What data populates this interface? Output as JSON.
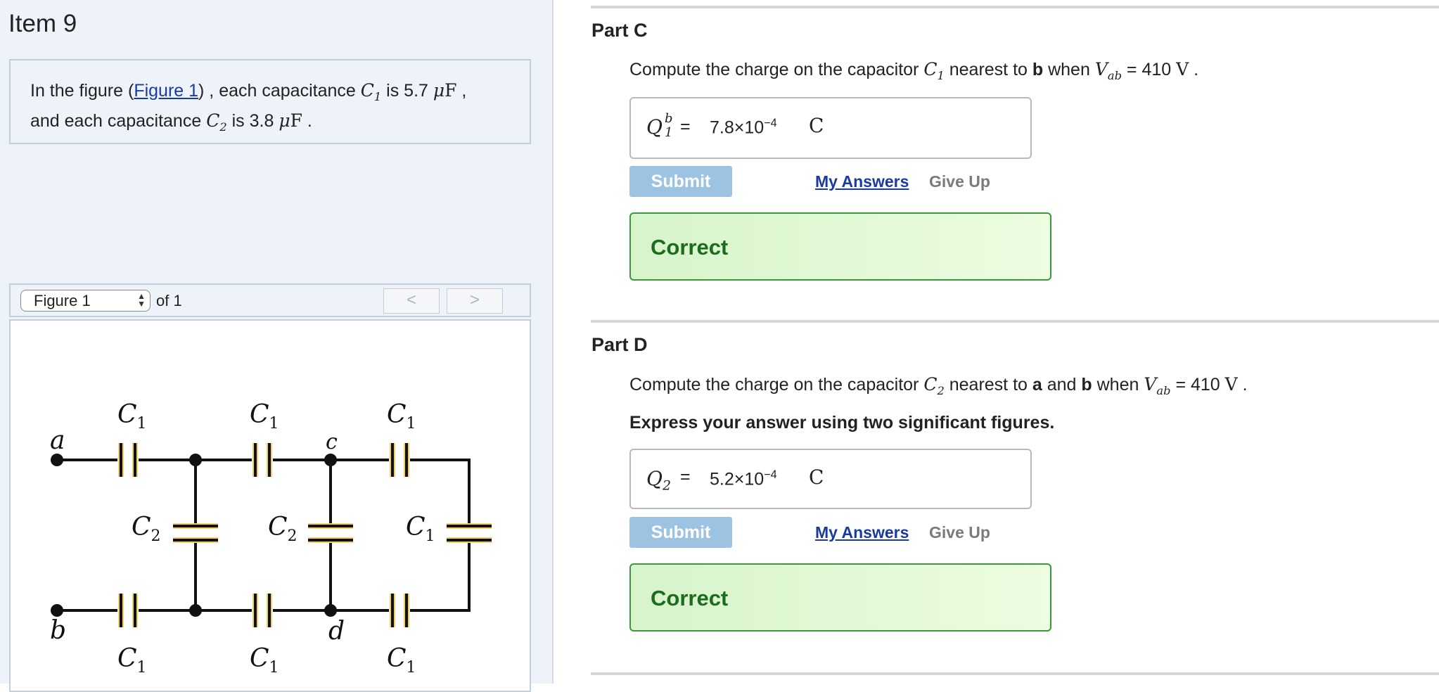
{
  "item_title": "Item 9",
  "problem": {
    "t1": "In the figure (",
    "link": "Figure 1",
    "t2": ") , each capacitance ",
    "c1_sym": "C",
    "c1_sub": "1",
    "t3": " is 5.7 ",
    "unit_mu": "μ",
    "unit_f": "F",
    "t4": " ,",
    "t5": "and each capacitance ",
    "c2_sym": "C",
    "c2_sub": "2",
    "t6": " is 3.8 ",
    "t7": " ."
  },
  "figure_nav": {
    "select_value": "Figure 1",
    "of_text": "of 1",
    "prev": "<",
    "next": ">"
  },
  "circuit": {
    "labels": {
      "a": "a",
      "b": "b",
      "c": "c",
      "d": "d",
      "C": "C",
      "sub1": "1",
      "sub2": "2"
    },
    "colors": {
      "plate": "#f2cf6a",
      "wire": "#111111"
    }
  },
  "part_c": {
    "title": "Part C",
    "q_pre": "Compute the charge on the capacitor ",
    "q_sym": "C",
    "q_sub": "1",
    "q_mid": " nearest to ",
    "q_bold": "b",
    "q_when": " when ",
    "v_sym": "V",
    "v_sub": "ab",
    "q_val": " = 410 ",
    "q_unit": "V",
    "q_end": " .",
    "answer_label": "Q",
    "answer_sup": "b",
    "answer_sub": "1",
    "answer_eq": "=",
    "answer_base": "7.8×10",
    "answer_exp": "−4",
    "answer_unit": "C",
    "submit": "Submit",
    "my_answers": "My Answers",
    "give_up": "Give Up",
    "feedback": "Correct"
  },
  "part_d": {
    "title": "Part D",
    "q_pre": "Compute the charge on the capacitor ",
    "q_sym": "C",
    "q_sub": "2",
    "q_mid": " nearest to ",
    "q_bold1": "a",
    "q_and": " and ",
    "q_bold2": "b",
    "q_when": " when ",
    "v_sym": "V",
    "v_sub": "ab",
    "q_val": " = 410 ",
    "q_unit": "V",
    "q_end": " .",
    "instruction": "Express your answer using two significant figures.",
    "answer_label": "Q",
    "answer_sub": "2",
    "answer_eq": "=",
    "answer_base": "5.2×10",
    "answer_exp": "−4",
    "answer_unit": "C",
    "submit": "Submit",
    "my_answers": "My Answers",
    "give_up": "Give Up",
    "feedback": "Correct"
  }
}
